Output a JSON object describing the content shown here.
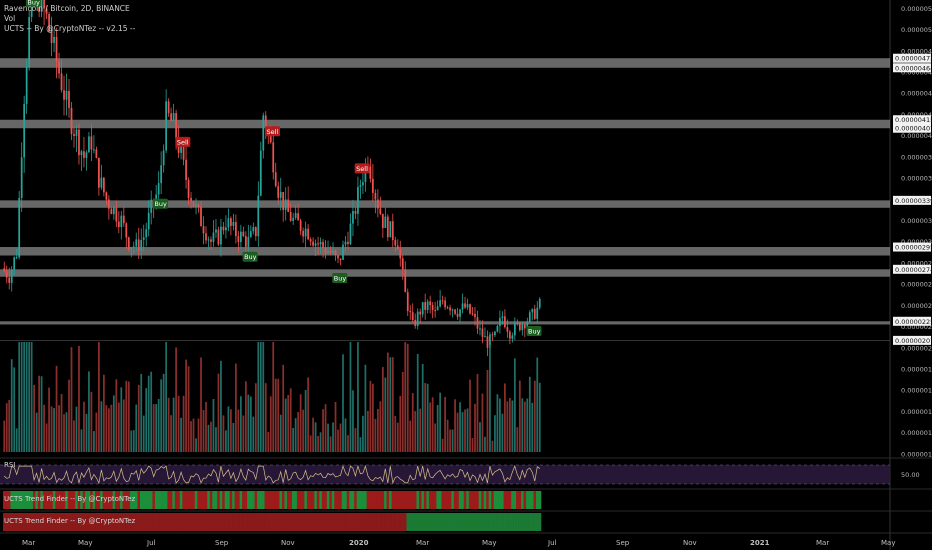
{
  "header": {
    "title": "Ravencoin / Bitcoin, 2D, BINANCE",
    "vol": "Vol",
    "indicator": "UCTS -- By @CryptoNTez -- v2.15 --"
  },
  "panes": {
    "rsi_label": "RSI",
    "rsi_level": "50.00",
    "trend_label_1": "UCTS Trend Finder -- By @CryptoNTez",
    "trend_label_2": "UCTS Trend Finder -- By @CryptoNTez"
  },
  "colors": {
    "up": "#26a69a",
    "down": "#ef5350",
    "zone": "#8a8a8a",
    "buy_bg": "#1b5e20",
    "sell_bg": "#b71c1c",
    "rsi_line": "#d8c08a",
    "rsi_band": "#2a1a3d"
  },
  "chart_data": {
    "type": "candlestick",
    "price_axis_ticks": [
      "0.00000520",
      "0.00000500",
      "0.00000480",
      "0.00000460",
      "0.00000440",
      "0.00000420",
      "0.00000400",
      "0.00000380",
      "0.00000360",
      "0.00000340",
      "0.00000320",
      "0.00000300",
      "0.00000280",
      "0.00000260",
      "0.00000240",
      "0.00000220",
      "0.00000200",
      "0.00000180",
      "0.00000160",
      "0.00000140",
      "0.00000120",
      "0.00000100"
    ],
    "price_range": [
      9.8e-07,
      5.26e-06
    ],
    "highlighted_levels": [
      "0.00000473",
      "0.00000464",
      "0.00000415",
      "0.00000407",
      "0.00000339",
      "0.00000295",
      "0.00000274",
      "0.00000225",
      "0.00000207"
    ],
    "support_resistance_zones": [
      [
        4.64e-06,
        4.73e-06
      ],
      [
        4.07e-06,
        4.15e-06
      ],
      [
        3.32e-06,
        3.39e-06
      ],
      [
        2.87e-06,
        2.95e-06
      ],
      [
        2.67e-06,
        2.74e-06
      ],
      [
        2.22e-06,
        2.25e-06
      ]
    ],
    "x_axis_labels": [
      "Mar",
      "May",
      "Jul",
      "Sep",
      "Nov",
      "2020",
      "Mar",
      "May",
      "Jul",
      "Sep",
      "Nov",
      "2021",
      "Mar",
      "May"
    ],
    "signals": [
      {
        "label": "Buy",
        "type": "buy"
      },
      {
        "label": "Buy",
        "type": "buy"
      },
      {
        "label": "Sell",
        "type": "sell"
      },
      {
        "label": "Buy",
        "type": "buy"
      },
      {
        "label": "Sell",
        "type": "sell"
      },
      {
        "label": "Buy",
        "type": "buy"
      },
      {
        "label": "Sell",
        "type": "sell"
      },
      {
        "label": "Buy",
        "type": "buy"
      }
    ],
    "close_path": [
      2.75e-06,
      2.68e-06,
      2.9e-06,
      4.4e-06,
      5.4e-06,
      5.3e-06,
      5.1e-06,
      4.8e-06,
      4.5e-06,
      4.2e-06,
      4e-06,
      3.8e-06,
      3.95e-06,
      3.6e-06,
      3.4e-06,
      3.3e-06,
      3.2e-06,
      3e-06,
      2.95e-06,
      3.05e-06,
      3.3e-06,
      3.5e-06,
      4.2e-06,
      4.1e-06,
      3.8e-06,
      3.5e-06,
      3.3e-06,
      3.15e-06,
      3e-06,
      3.05e-06,
      3.2e-06,
      3.1e-06,
      3.05e-06,
      3e-06,
      3.1e-06,
      4.2e-06,
      3.9e-06,
      3.5e-06,
      3.3e-06,
      3.2e-06,
      3.15e-06,
      3.1e-06,
      3e-06,
      2.95e-06,
      2.9e-06,
      2.8e-06,
      3e-06,
      3.2e-06,
      3.55e-06,
      3.8e-06,
      3.45e-06,
      3.2e-06,
      3.1e-06,
      3e-06,
      2.5e-06,
      2.2e-06,
      2.35e-06,
      2.4e-06,
      2.32e-06,
      2.45e-06,
      2.4e-06,
      2.35e-06,
      2.38e-06,
      2.3e-06,
      2.15e-06,
      2.05e-06,
      2.1e-06,
      2.3e-06,
      2.15e-06,
      2.2e-06,
      2.25e-06,
      2.3e-06,
      2.4e-06
    ]
  }
}
